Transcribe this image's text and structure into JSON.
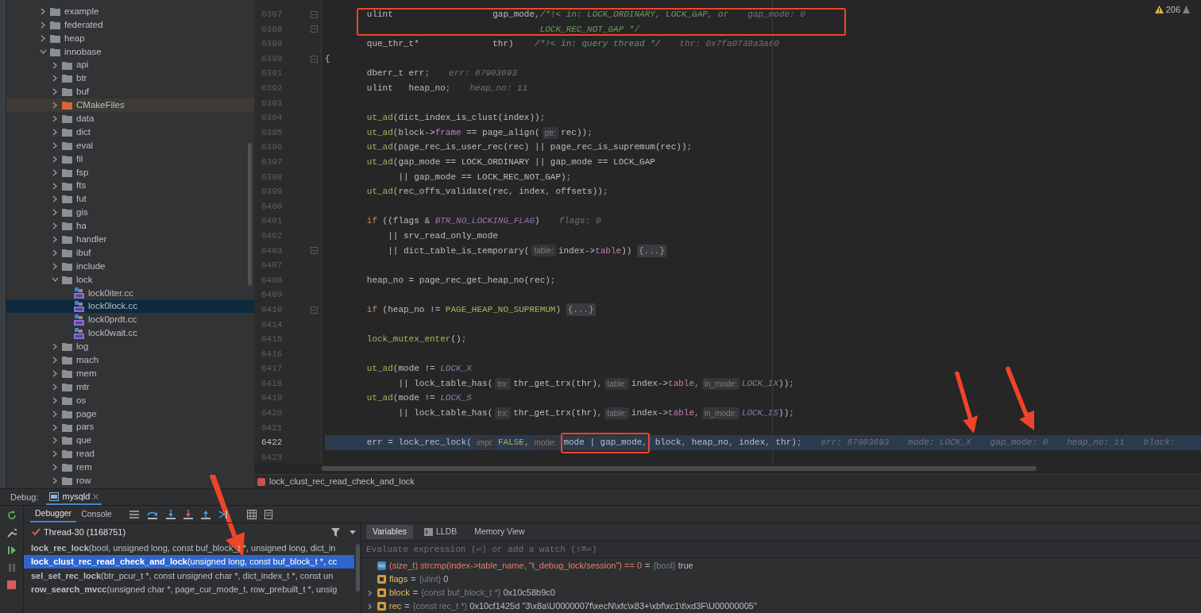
{
  "project_tree": {
    "items": [
      {
        "label": "example",
        "kind": "folder",
        "expanded": false,
        "selected": false
      },
      {
        "label": "federated",
        "kind": "folder",
        "expanded": false,
        "selected": false
      },
      {
        "label": "heap",
        "kind": "folder",
        "expanded": false,
        "selected": false
      },
      {
        "label": "innobase",
        "kind": "folder",
        "expanded": true,
        "selected": false,
        "children": [
          {
            "label": "api",
            "kind": "folder",
            "expanded": false,
            "selected": false
          },
          {
            "label": "btr",
            "kind": "folder",
            "expanded": false,
            "selected": false
          },
          {
            "label": "buf",
            "kind": "folder",
            "expanded": false,
            "selected": false
          },
          {
            "label": "CMakeFiles",
            "kind": "excluded_folder",
            "expanded": false,
            "selected": false
          },
          {
            "label": "data",
            "kind": "folder",
            "expanded": false,
            "selected": false
          },
          {
            "label": "dict",
            "kind": "folder",
            "expanded": false,
            "selected": false
          },
          {
            "label": "eval",
            "kind": "folder",
            "expanded": false,
            "selected": false
          },
          {
            "label": "fil",
            "kind": "folder",
            "expanded": false,
            "selected": false
          },
          {
            "label": "fsp",
            "kind": "folder",
            "expanded": false,
            "selected": false
          },
          {
            "label": "fts",
            "kind": "folder",
            "expanded": false,
            "selected": false
          },
          {
            "label": "fut",
            "kind": "folder",
            "expanded": false,
            "selected": false
          },
          {
            "label": "gis",
            "kind": "folder",
            "expanded": false,
            "selected": false
          },
          {
            "label": "ha",
            "kind": "folder",
            "expanded": false,
            "selected": false
          },
          {
            "label": "handler",
            "kind": "folder",
            "expanded": false,
            "selected": false
          },
          {
            "label": "ibuf",
            "kind": "folder",
            "expanded": false,
            "selected": false
          },
          {
            "label": "include",
            "kind": "folder",
            "expanded": false,
            "selected": false
          },
          {
            "label": "lock",
            "kind": "folder",
            "expanded": true,
            "selected": false,
            "children": [
              {
                "label": "lock0iter.cc",
                "kind": "file",
                "selected": false
              },
              {
                "label": "lock0lock.cc",
                "kind": "file",
                "selected": true
              },
              {
                "label": "lock0prdt.cc",
                "kind": "file",
                "selected": false
              },
              {
                "label": "lock0wait.cc",
                "kind": "file",
                "selected": false
              }
            ]
          },
          {
            "label": "log",
            "kind": "folder",
            "expanded": false,
            "selected": false
          },
          {
            "label": "mach",
            "kind": "folder",
            "expanded": false,
            "selected": false
          },
          {
            "label": "mem",
            "kind": "folder",
            "expanded": false,
            "selected": false
          },
          {
            "label": "mtr",
            "kind": "folder",
            "expanded": false,
            "selected": false
          },
          {
            "label": "os",
            "kind": "folder",
            "expanded": false,
            "selected": false
          },
          {
            "label": "page",
            "kind": "folder",
            "expanded": false,
            "selected": false
          },
          {
            "label": "pars",
            "kind": "folder",
            "expanded": false,
            "selected": false
          },
          {
            "label": "que",
            "kind": "folder",
            "expanded": false,
            "selected": false
          },
          {
            "label": "read",
            "kind": "folder",
            "expanded": false,
            "selected": false
          },
          {
            "label": "rem",
            "kind": "folder",
            "expanded": false,
            "selected": false
          },
          {
            "label": "row",
            "kind": "folder",
            "expanded": false,
            "selected": false
          }
        ]
      }
    ]
  },
  "editor": {
    "warnings": "206",
    "lines": [
      {
        "number": "6387",
        "fold": true,
        "current": false,
        "segments": [
          {
            "kind": "plain",
            "text": "        ulint                   gap_mode"
          },
          {
            "kind": "punct",
            "text": ","
          },
          {
            "kind": "comment",
            "text": "/*!< in: LOCK_ORDINARY, LOCK_GAP, or"
          },
          {
            "kind": "value",
            "text": "gap_mode: 0"
          }
        ]
      },
      {
        "number": "6388",
        "fold": true,
        "current": false,
        "segments": [
          {
            "kind": "comment",
            "text": "                                         LOCK_REC_NOT_GAP */"
          }
        ]
      },
      {
        "number": "6389",
        "fold": false,
        "current": false,
        "segments": [
          {
            "kind": "plain",
            "text": "        que_thr_t*              thr)    "
          },
          {
            "kind": "comment",
            "text": "/*!< in: query thread */"
          },
          {
            "kind": "value",
            "text": "thr: 0x7fa0738a3a60"
          }
        ]
      },
      {
        "number": "6390",
        "fold": true,
        "current": false,
        "segments": [
          {
            "kind": "plain",
            "text": "{"
          }
        ]
      },
      {
        "number": "6391",
        "fold": false,
        "current": false,
        "segments": [
          {
            "kind": "plain",
            "text": "        dberr_t err"
          },
          {
            "kind": "punct",
            "text": ";"
          },
          {
            "kind": "value",
            "text": "err: 67903693"
          }
        ]
      },
      {
        "number": "6392",
        "fold": false,
        "current": false,
        "segments": [
          {
            "kind": "plain",
            "text": "        ulint   heap_no"
          },
          {
            "kind": "punct",
            "text": ";"
          },
          {
            "kind": "value",
            "text": "heap_no: 11"
          }
        ]
      },
      {
        "number": "6393",
        "fold": false,
        "current": false
      },
      {
        "number": "6394",
        "fold": false,
        "current": false,
        "segments": [
          {
            "kind": "macro",
            "text": "        ut_ad"
          },
          {
            "kind": "plain",
            "text": "(dict_index_is_clust(index))"
          },
          {
            "kind": "punct",
            "text": ";"
          }
        ]
      },
      {
        "number": "6395",
        "fold": false,
        "current": false,
        "segments": [
          {
            "kind": "macro",
            "text": "        ut_ad"
          },
          {
            "kind": "plain",
            "text": "(block->"
          },
          {
            "kind": "field",
            "text": "frame"
          },
          {
            "kind": "plain",
            "text": " == page_align("
          },
          {
            "kind": "hint",
            "text": "ptr:"
          },
          {
            "kind": "plain",
            "text": "rec))"
          },
          {
            "kind": "punct",
            "text": ";"
          }
        ]
      },
      {
        "number": "6396",
        "fold": false,
        "current": false,
        "segments": [
          {
            "kind": "macro",
            "text": "        ut_ad"
          },
          {
            "kind": "plain",
            "text": "(page_rec_is_user_rec(rec) || page_rec_is_supremum(rec))"
          },
          {
            "kind": "punct",
            "text": ";"
          }
        ]
      },
      {
        "number": "6397",
        "fold": false,
        "current": false,
        "segments": [
          {
            "kind": "macro",
            "text": "        ut_ad"
          },
          {
            "kind": "plain",
            "text": "(gap_mode == LOCK_ORDINARY || gap_mode == LOCK_GAP"
          }
        ]
      },
      {
        "number": "6398",
        "fold": false,
        "current": false,
        "segments": [
          {
            "kind": "plain",
            "text": "              || gap_mode == LOCK_REC_NOT_GAP)"
          },
          {
            "kind": "punct",
            "text": ";"
          }
        ]
      },
      {
        "number": "6399",
        "fold": false,
        "current": false,
        "segments": [
          {
            "kind": "macro",
            "text": "        ut_ad"
          },
          {
            "kind": "plain",
            "text": "(rec_offs_validate(rec"
          },
          {
            "kind": "punct",
            "text": ","
          },
          {
            "kind": "plain",
            "text": " index"
          },
          {
            "kind": "punct",
            "text": ","
          },
          {
            "kind": "plain",
            "text": " offsets))"
          },
          {
            "kind": "punct",
            "text": ";"
          }
        ]
      },
      {
        "number": "6400",
        "fold": false,
        "current": false
      },
      {
        "number": "6401",
        "fold": false,
        "current": false,
        "segments": [
          {
            "kind": "keyword",
            "text": "        if"
          },
          {
            "kind": "plain",
            "text": " ((flags & "
          },
          {
            "kind": "constant",
            "text": "BTR_NO_LOCKING_FLAG"
          },
          {
            "kind": "plain",
            "text": ")"
          },
          {
            "kind": "value",
            "text": "flags: 0"
          }
        ]
      },
      {
        "number": "6402",
        "fold": false,
        "current": false,
        "segments": [
          {
            "kind": "plain",
            "text": "            || srv_read_only_mode"
          }
        ]
      },
      {
        "number": "6403",
        "fold": true,
        "current": false,
        "segments": [
          {
            "kind": "plain",
            "text": "            || dict_table_is_temporary("
          },
          {
            "kind": "hint",
            "text": "table:"
          },
          {
            "kind": "plain",
            "text": "index->"
          },
          {
            "kind": "field",
            "text": "table"
          },
          {
            "kind": "plain",
            "text": ")) "
          },
          {
            "kind": "folded",
            "text": "{...}"
          }
        ]
      },
      {
        "number": "6407",
        "fold": false,
        "current": false
      },
      {
        "number": "6408",
        "fold": false,
        "current": false,
        "segments": [
          {
            "kind": "plain",
            "text": "        heap_no = page_rec_get_heap_no(rec)"
          },
          {
            "kind": "punct",
            "text": ";"
          }
        ]
      },
      {
        "number": "6409",
        "fold": false,
        "current": false
      },
      {
        "number": "6410",
        "fold": true,
        "current": false,
        "segments": [
          {
            "kind": "keyword",
            "text": "        if"
          },
          {
            "kind": "plain",
            "text": " (heap_no != "
          },
          {
            "kind": "literal",
            "text": "PAGE_HEAP_NO_SUPREMUM"
          },
          {
            "kind": "plain",
            "text": ") "
          },
          {
            "kind": "folded",
            "text": "{...}"
          }
        ]
      },
      {
        "number": "6414",
        "fold": false,
        "current": false
      },
      {
        "number": "6415",
        "fold": false,
        "current": false,
        "segments": [
          {
            "kind": "macro",
            "text": "        lock_mutex_enter"
          },
          {
            "kind": "plain",
            "text": "()"
          },
          {
            "kind": "punct",
            "text": ";"
          }
        ]
      },
      {
        "number": "6416",
        "fold": false,
        "current": false
      },
      {
        "number": "6417",
        "fold": false,
        "current": false,
        "segments": [
          {
            "kind": "macro",
            "text": "        ut_ad"
          },
          {
            "kind": "plain",
            "text": "(mode != "
          },
          {
            "kind": "constant",
            "text": "LOCK_X"
          }
        ]
      },
      {
        "number": "6418",
        "fold": false,
        "current": false,
        "segments": [
          {
            "kind": "plain",
            "text": "              || lock_table_has("
          },
          {
            "kind": "hint",
            "text": "trx:"
          },
          {
            "kind": "plain",
            "text": "thr_get_trx(thr)"
          },
          {
            "kind": "punct",
            "text": ","
          },
          {
            "kind": "hint",
            "text": "table:"
          },
          {
            "kind": "plain",
            "text": "index->"
          },
          {
            "kind": "field",
            "text": "table"
          },
          {
            "kind": "punct",
            "text": ","
          },
          {
            "kind": "hint",
            "text": "in_mode:"
          },
          {
            "kind": "constant",
            "text": "LOCK_IX"
          },
          {
            "kind": "plain",
            "text": "))"
          },
          {
            "kind": "punct",
            "text": ";"
          }
        ]
      },
      {
        "number": "6419",
        "fold": false,
        "current": false,
        "segments": [
          {
            "kind": "macro",
            "text": "        ut_ad"
          },
          {
            "kind": "plain",
            "text": "(mode != "
          },
          {
            "kind": "constant",
            "text": "LOCK_S"
          }
        ]
      },
      {
        "number": "6420",
        "fold": false,
        "current": false,
        "segments": [
          {
            "kind": "plain",
            "text": "              || lock_table_has("
          },
          {
            "kind": "hint",
            "text": "trx:"
          },
          {
            "kind": "plain",
            "text": "thr_get_trx(thr)"
          },
          {
            "kind": "punct",
            "text": ","
          },
          {
            "kind": "hint",
            "text": "table:"
          },
          {
            "kind": "plain",
            "text": "index->"
          },
          {
            "kind": "field",
            "text": "table"
          },
          {
            "kind": "punct",
            "text": ","
          },
          {
            "kind": "hint",
            "text": "in_mode:"
          },
          {
            "kind": "constant",
            "text": "LOCK_IS"
          },
          {
            "kind": "plain",
            "text": "))"
          },
          {
            "kind": "punct",
            "text": ";"
          }
        ]
      },
      {
        "number": "6421",
        "fold": false,
        "current": false
      },
      {
        "number": "6422",
        "fold": false,
        "current": true,
        "segments": [
          {
            "kind": "plain",
            "text": "        err = lock_rec_lock("
          },
          {
            "kind": "hint",
            "text": "impl:"
          },
          {
            "kind": "literal",
            "text": "FALSE"
          },
          {
            "kind": "punct",
            "text": ","
          },
          {
            "kind": "hint",
            "text": "mode:"
          },
          {
            "kind": "annotated",
            "segments": [
              {
                "kind": "plain",
                "text": "mode | gap_mode"
              },
              {
                "kind": "punct",
                "text": ","
              }
            ]
          },
          {
            "kind": "plain",
            "text": " block"
          },
          {
            "kind": "punct",
            "text": ","
          },
          {
            "kind": "plain",
            "text": " heap_no"
          },
          {
            "kind": "punct",
            "text": ","
          },
          {
            "kind": "plain",
            "text": " index"
          },
          {
            "kind": "punct",
            "text": ","
          },
          {
            "kind": "plain",
            "text": " thr)"
          },
          {
            "kind": "punct",
            "text": ";"
          },
          {
            "kind": "value",
            "text": "err: 67903693"
          },
          {
            "kind": "value",
            "text": "mode: LOCK_X"
          },
          {
            "kind": "value",
            "text": "gap_mode: 0"
          },
          {
            "kind": "value",
            "text": "heap_no: 11"
          },
          {
            "kind": "value",
            "text": "block:"
          }
        ]
      },
      {
        "number": "6423",
        "fold": false,
        "current": false
      }
    ],
    "breadcrumb": "lock_clust_rec_read_check_and_lock"
  },
  "debug_panel": {
    "label": "Debug:",
    "session_tab": "mysqld",
    "tabs": [
      {
        "label": "Debugger",
        "selected": true
      },
      {
        "label": "Console",
        "selected": false
      }
    ],
    "thread": "Thread-30 (1168751)",
    "frames": [
      {
        "text": "**lock_rec_lock**(bool, unsigned long, const buf_block_t *, unsigned long, dict_in",
        "selected": false
      },
      {
        "text": "**lock_clust_rec_read_check_and_lock**(unsigned long, const buf_block_t *, cc",
        "selected": true
      },
      {
        "text": "**sel_set_rec_lock**(btr_pcur_t *, const unsigned char *, dict_index_t *, const un",
        "selected": false
      },
      {
        "text": "**row_search_mvcc**(unsigned char *, page_cur_mode_t, row_prebuilt_t *, unsig",
        "selected": false
      }
    ],
    "variable_tabs": [
      {
        "label": "Variables",
        "selected": true
      },
      {
        "label": "LLDB",
        "selected": false
      },
      {
        "label": "Memory View",
        "selected": false
      }
    ],
    "evaluate": {
      "placeholder": "Evaluate expression (⏎) or add a watch (⇧⌘⏎)"
    },
    "variables": [
      {
        "kind": "watch",
        "name": "(size_t) strcmp(index->table_name, \"t_debug_lock/session\") == 0",
        "operator": "=",
        "type": "{bool}",
        "value": "true",
        "expandable": false
      },
      {
        "kind": "variable",
        "name": "flags",
        "operator": "=",
        "type": "{ulint}",
        "value": "0",
        "expandable": false
      },
      {
        "kind": "variable",
        "name": "block",
        "operator": "=",
        "type": "{const buf_block_t *}",
        "value": "0x10c58b9c0",
        "expandable": true
      },
      {
        "kind": "variable",
        "name": "rec",
        "operator": "=",
        "type": "{const rec_t *}",
        "value": "0x10cf1425d \"3\\x8a\\U0000007f\\xecN\\xfc\\x83+\\xbf\\xc1\\t\\xd3F\\U00000005\"",
        "expandable": true
      }
    ]
  }
}
